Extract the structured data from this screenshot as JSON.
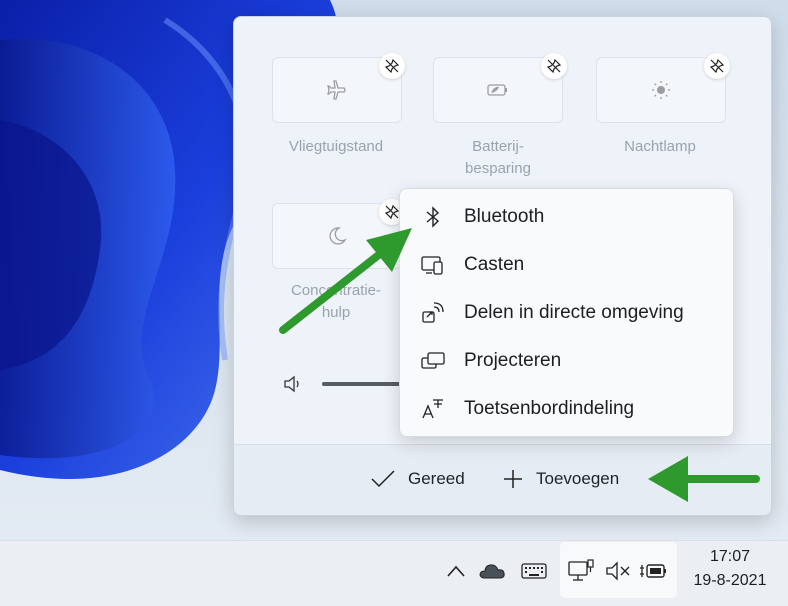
{
  "tiles": [
    {
      "label": "Vliegtuigstand",
      "icon": "airplane-icon"
    },
    {
      "label": "Batterij-\nbesparing",
      "icon": "battery-saver-icon"
    },
    {
      "label": "Nachtlamp",
      "icon": "brightness-icon"
    },
    {
      "label": "Concentratie-\nhulp",
      "icon": "moon-icon"
    }
  ],
  "context_menu": {
    "items": [
      {
        "label": "Bluetooth",
        "icon": "bluetooth-icon"
      },
      {
        "label": "Casten",
        "icon": "cast-icon"
      },
      {
        "label": "Delen in directe omgeving",
        "icon": "nearby-share-icon"
      },
      {
        "label": "Projecteren",
        "icon": "project-icon"
      },
      {
        "label": "Toetsenbordindeling",
        "icon": "keyboard-layout-icon"
      }
    ]
  },
  "footer": {
    "done_label": "Gereed",
    "add_label": "Toevoegen"
  },
  "taskbar": {
    "time": "17:07",
    "date": "19-8-2021"
  },
  "colors": {
    "arrow": "#2e9a2e",
    "wallpaper_accent": "#1f3fd0"
  }
}
